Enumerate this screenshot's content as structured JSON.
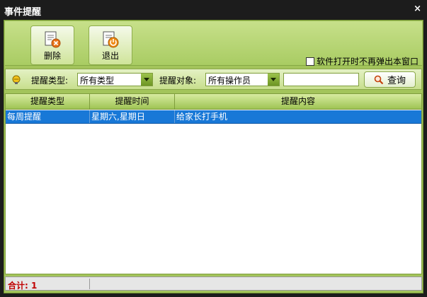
{
  "window": {
    "title": "事件提醒",
    "close_glyph": "×"
  },
  "toolbar": {
    "delete_label": "删除",
    "delete_icon": "delete-document-icon",
    "exit_label": "退出",
    "exit_icon": "exit-power-icon",
    "no_popup_label": "软件打开时不再弹出本窗口",
    "no_popup_checked": false
  },
  "filter": {
    "type_label": "提醒类型:",
    "type_value": "所有类型",
    "target_label": "提醒对象:",
    "target_value": "所有操作员",
    "search_value": "",
    "query_label": "查询",
    "bulb_icon": "lightbulb-icon",
    "query_icon": "search-icon"
  },
  "grid": {
    "columns": [
      "提醒类型",
      "提醒时间",
      "提醒内容"
    ],
    "rows": [
      [
        "每周提醒",
        "星期六,星期日",
        "给家长打手机"
      ]
    ],
    "selected_row": 0
  },
  "status": {
    "total": "合计: 1"
  },
  "colors": {
    "accent": "#a3c45b",
    "selection": "#1878d7",
    "total_text": "#c00000"
  }
}
